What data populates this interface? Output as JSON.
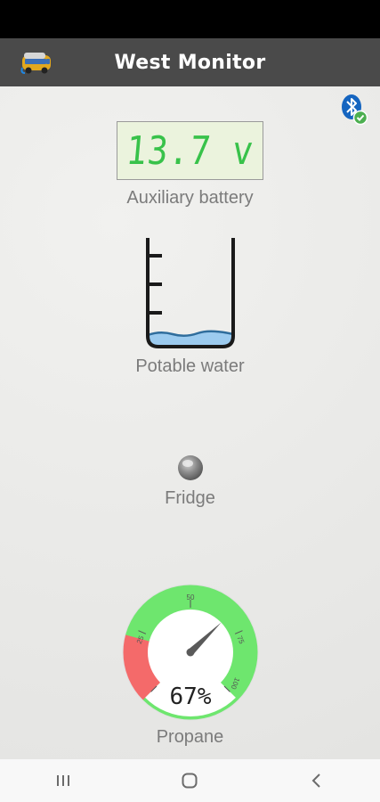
{
  "app": {
    "title": "West Monitor"
  },
  "battery": {
    "value": "13.7 v",
    "label": "Auxiliary battery"
  },
  "water": {
    "label": "Potable water",
    "level_fraction": 0.1
  },
  "fridge": {
    "label": "Fridge",
    "status": "off"
  },
  "propane": {
    "label": "Propane",
    "value_text": "67%",
    "percent": 67,
    "ticks": [
      "25",
      "50",
      "75",
      "100"
    ]
  },
  "colors": {
    "app_bar": "#4a4a4a",
    "lcd_digits": "#38c24a",
    "gauge_green": "#6ee66e",
    "gauge_red": "#f46a6a",
    "water": "#9ccbef",
    "bluetooth": "#1565c0"
  },
  "icons": {
    "logo": "camper-van-icon",
    "bluetooth": "bluetooth-connected-icon",
    "nav": [
      "recent-apps-icon",
      "home-icon",
      "back-icon"
    ]
  }
}
